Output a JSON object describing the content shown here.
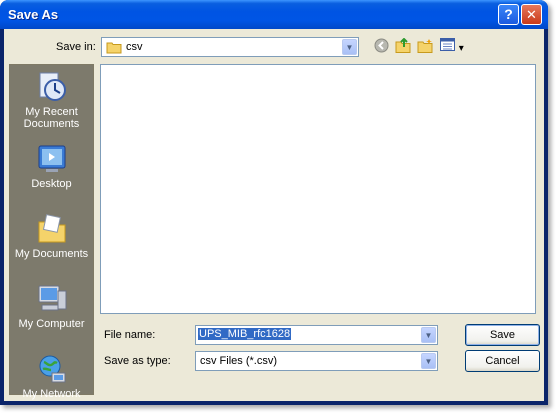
{
  "window": {
    "title": "Save As"
  },
  "toolbar": {
    "save_in_label": "Save in:",
    "save_in_value": "csv",
    "view_menu_arrow": "▾"
  },
  "places": [
    {
      "label_line1": "My Recent",
      "label_line2": "Documents",
      "icon": "recent-documents-icon"
    },
    {
      "label_line1": "Desktop",
      "label_line2": "",
      "icon": "desktop-icon"
    },
    {
      "label_line1": "My Documents",
      "label_line2": "",
      "icon": "my-documents-icon"
    },
    {
      "label_line1": "My Computer",
      "label_line2": "",
      "icon": "my-computer-icon"
    },
    {
      "label_line1": "My Network",
      "label_line2": "",
      "icon": "my-network-icon"
    }
  ],
  "form": {
    "file_name_label": "File name:",
    "file_name_value": "UPS_MIB_rfc1628",
    "save_type_label": "Save as type:",
    "save_type_value": "csv Files (*.csv)"
  },
  "buttons": {
    "save": "Save",
    "cancel": "Cancel"
  },
  "window_buttons": {
    "help": "?",
    "close": "✕"
  },
  "colors": {
    "titlebar": "#0054e3",
    "client": "#ece9d8",
    "places_bg": "#7d7a6c",
    "selection": "#316ac5"
  }
}
